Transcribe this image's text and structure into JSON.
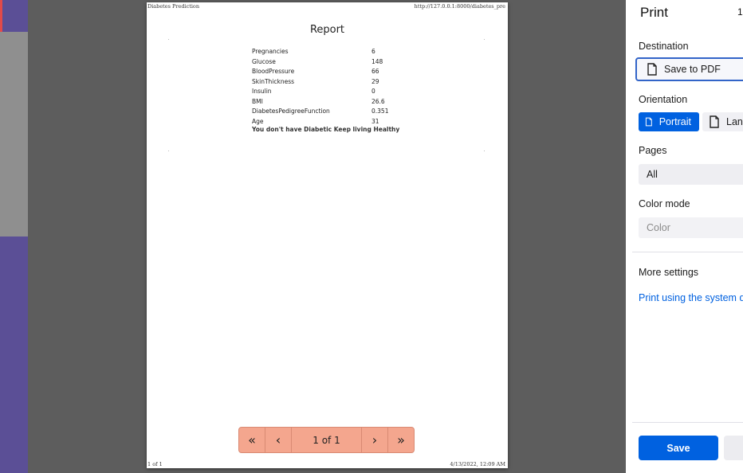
{
  "page": {
    "header_left": "Diabetes Prediction",
    "header_right": "http://127.0.0.1:8000/diabetes_pre",
    "footer_left": "1 of 1",
    "footer_right": "4/13/2022, 12:09 AM",
    "title": "Report",
    "fields": [
      {
        "label": "Pregnancies",
        "value": "6"
      },
      {
        "label": "Glucose",
        "value": "148"
      },
      {
        "label": "BloodPressure",
        "value": "66"
      },
      {
        "label": "SkinThickness",
        "value": "29"
      },
      {
        "label": "Insulin",
        "value": "0"
      },
      {
        "label": "BMI",
        "value": "26.6"
      },
      {
        "label": "DiabetesPedigreeFunction",
        "value": "0.351"
      },
      {
        "label": "Age",
        "value": "31"
      }
    ],
    "result": "You don't have Diabetic Keep living Healthy"
  },
  "pager": {
    "label": "1 of 1",
    "first_icon": "«",
    "prev_icon": "‹",
    "next_icon": "›",
    "last_icon": "»"
  },
  "panel": {
    "title": "Print",
    "sheet_count": "1",
    "destination_label": "Destination",
    "destination_value": "Save to PDF",
    "orientation_label": "Orientation",
    "portrait_label": "Portrait",
    "landscape_label": "Land",
    "pages_label": "Pages",
    "pages_value": "All",
    "color_mode_label": "Color mode",
    "color_mode_value": "Color",
    "more_settings": "More settings",
    "system_dialog_link": "Print using the system di",
    "save_label": "Save"
  }
}
